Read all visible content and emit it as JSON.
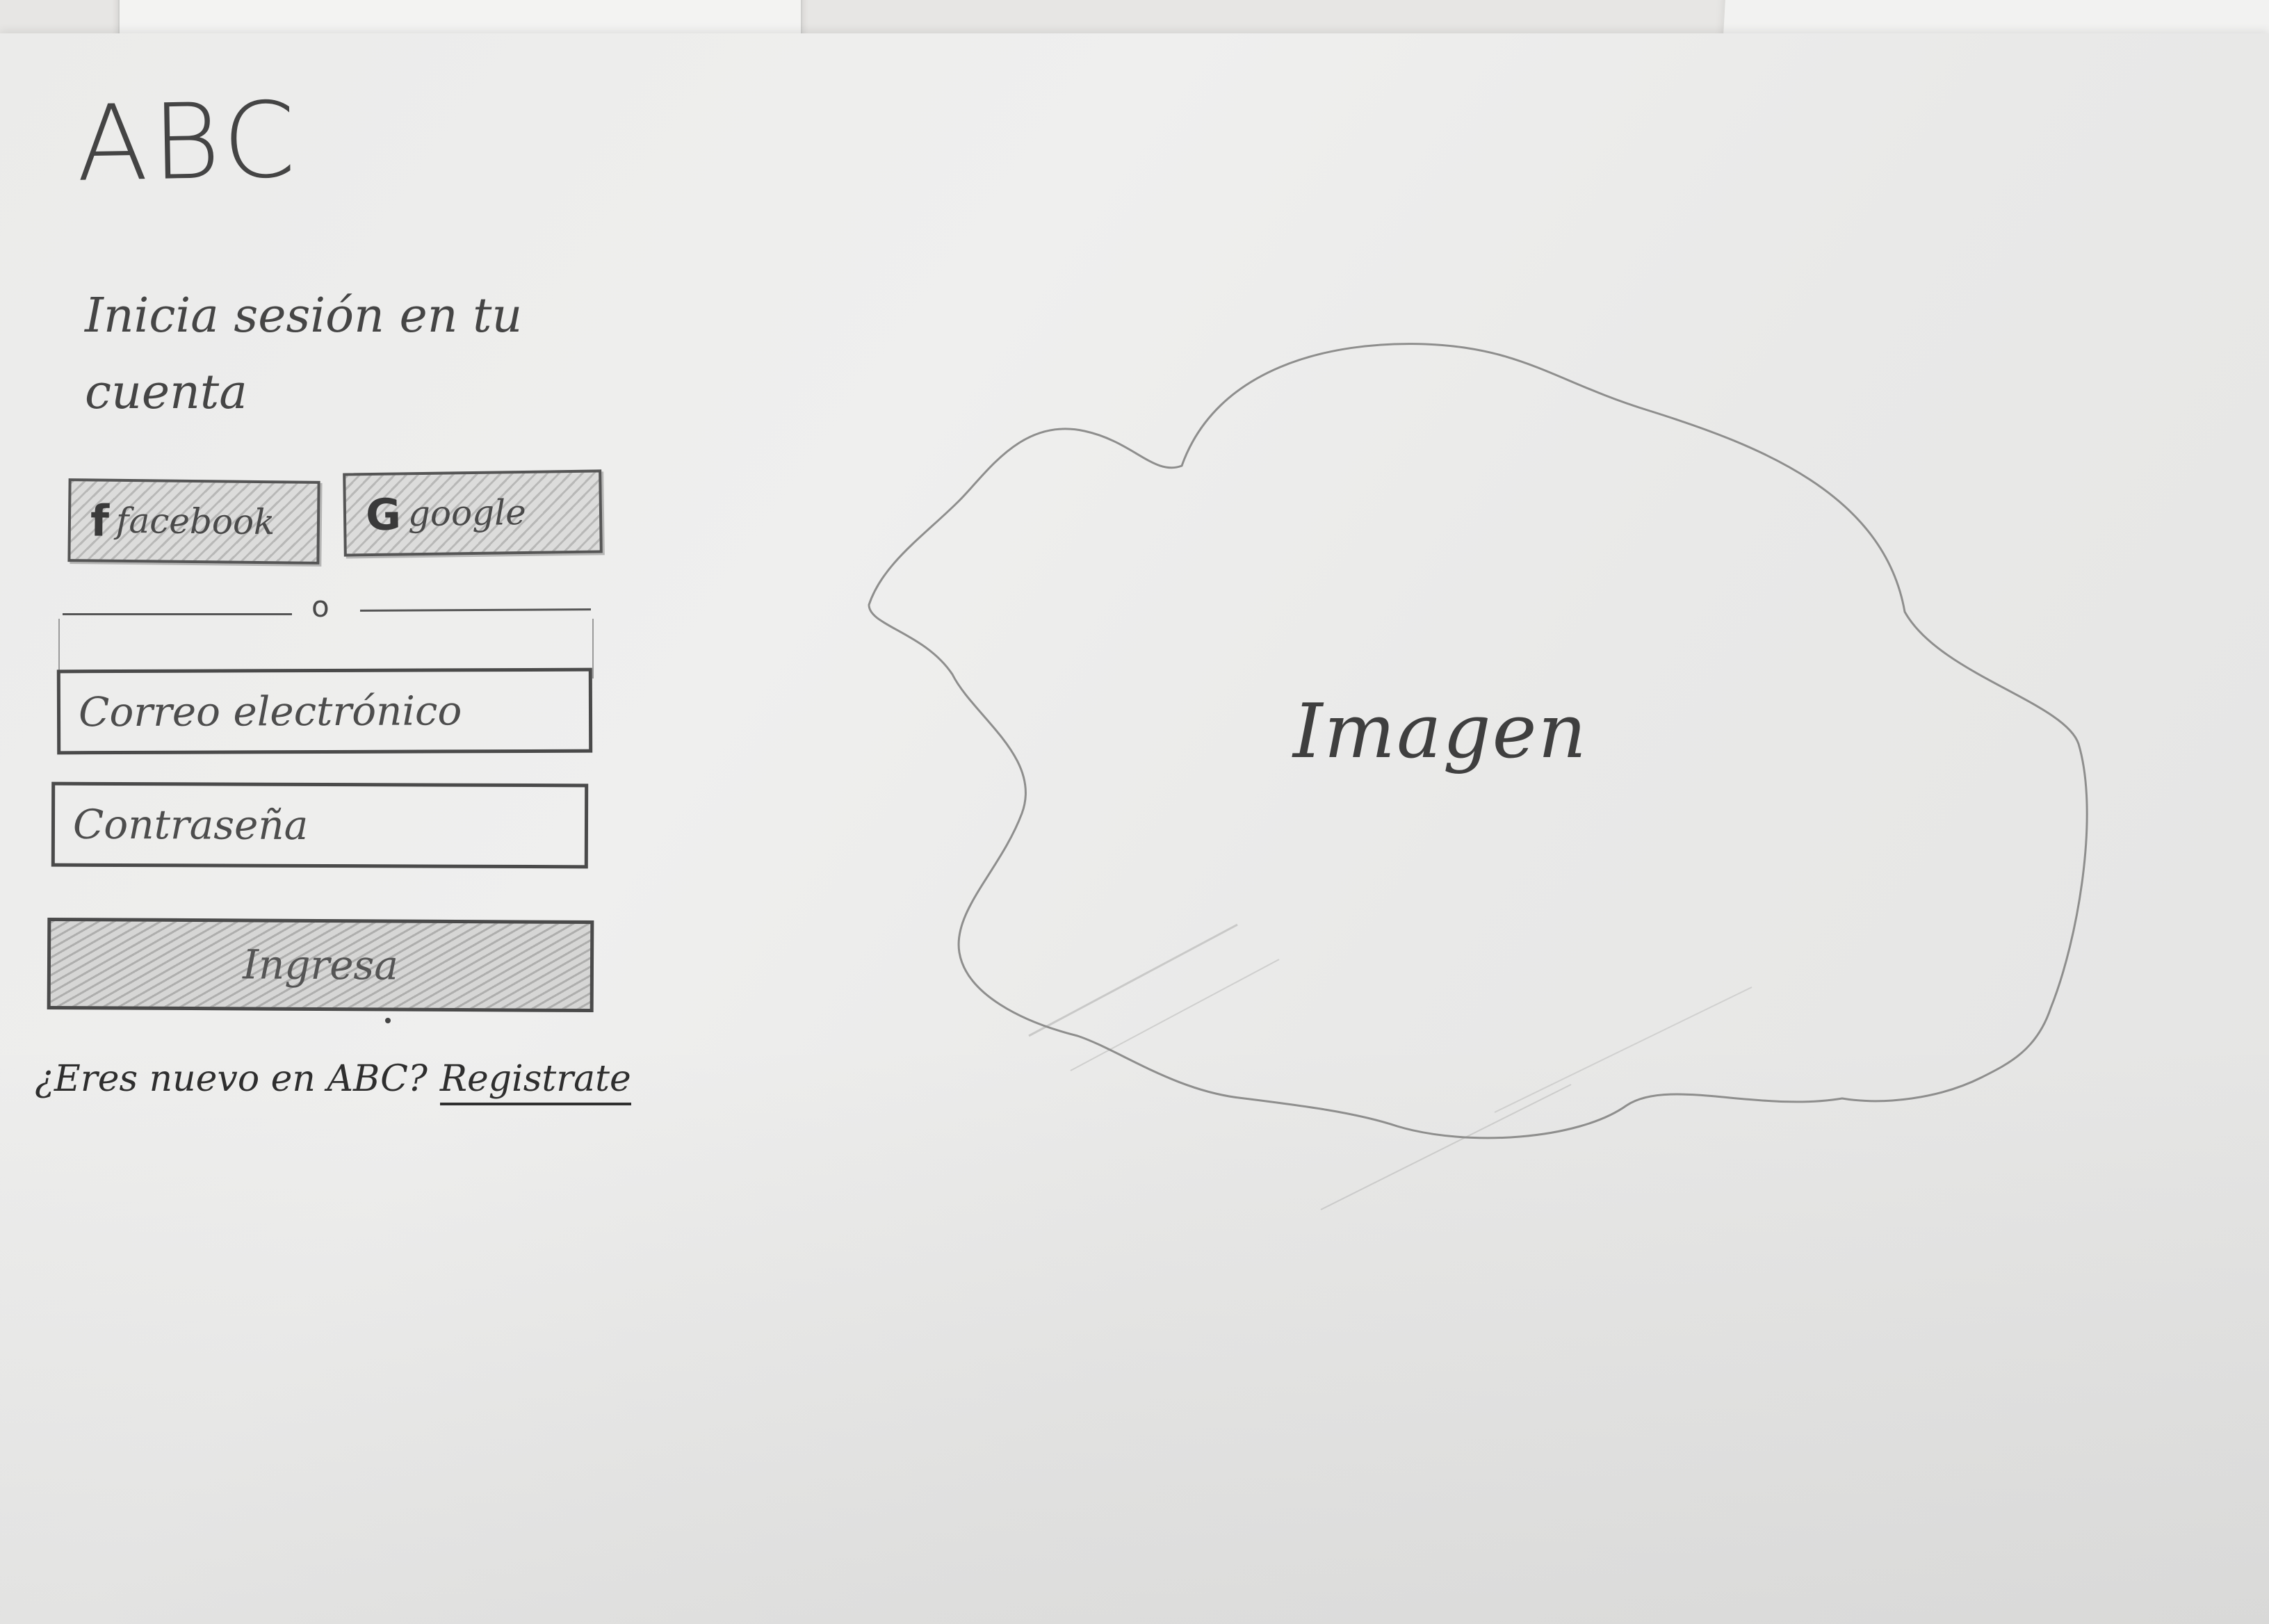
{
  "app": {
    "logo_text": "ABC"
  },
  "login": {
    "heading": "Inicia sesión en tu cuenta",
    "social": {
      "facebook": {
        "icon": "f",
        "label": "facebook"
      },
      "google": {
        "icon": "G",
        "label": "google"
      }
    },
    "divider_text": "o",
    "email": {
      "placeholder": "Correo electrónico"
    },
    "password": {
      "placeholder": "Contraseña"
    },
    "submit_label": "Ingresa",
    "signup": {
      "prompt": "¿Eres nuevo en ABC?",
      "link_label": "Registrate"
    }
  },
  "hero": {
    "image_label": "Imagen"
  }
}
